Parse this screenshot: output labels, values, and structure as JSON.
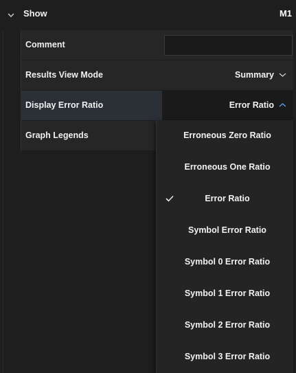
{
  "header": {
    "title": "Show",
    "badge": "M1"
  },
  "properties": {
    "comment": {
      "label": "Comment",
      "value": ""
    },
    "results_view_mode": {
      "label": "Results View Mode",
      "value": "Summary"
    },
    "display_error_ratio": {
      "label": "Display Error Ratio",
      "value": "Error Ratio"
    },
    "graph_legends": {
      "label": "Graph Legends"
    }
  },
  "dropdown": {
    "selected": "Error Ratio",
    "options": [
      "Erroneous Zero Ratio",
      "Erroneous One Ratio",
      "Error Ratio",
      "Symbol Error Ratio",
      "Symbol 0 Error Ratio",
      "Symbol 1 Error Ratio",
      "Symbol 2 Error Ratio",
      "Symbol 3 Error Ratio"
    ]
  },
  "colors": {
    "background": "#1e1e1e",
    "row": "#262626",
    "active_row": "#2b2f36",
    "accent": "#4a8fe7"
  },
  "icons": {
    "collapse": "chevron-down-icon",
    "select_closed": "chevron-down-icon",
    "select_open": "chevron-up-icon",
    "selected_marker": "check-icon"
  }
}
